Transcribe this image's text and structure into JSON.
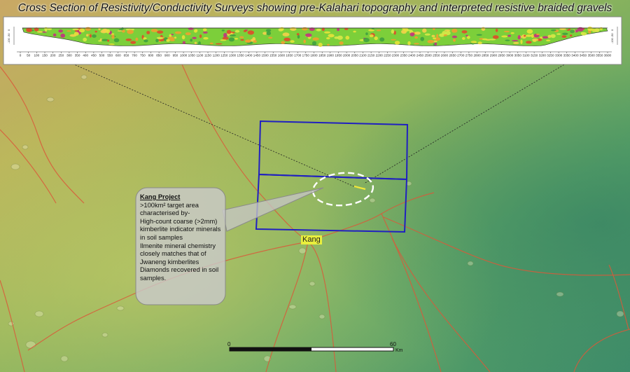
{
  "title": "Cross Section  of Resistivity/Conductivity Surveys showing pre-Kalahari topography  and interpreted resistive braided gravels",
  "cross_section": {
    "x_ticks": [
      "0",
      "50",
      "100",
      "150",
      "200",
      "250",
      "300",
      "350",
      "400",
      "450",
      "500",
      "550",
      "600",
      "650",
      "700",
      "750",
      "800",
      "850",
      "900",
      "950",
      "1000",
      "1050",
      "1100",
      "1150",
      "1200",
      "1250",
      "1300",
      "1350",
      "1400",
      "1450",
      "1500",
      "1550",
      "1600",
      "1650",
      "1700",
      "1750",
      "1800",
      "1850",
      "1900",
      "1950",
      "2000",
      "2050",
      "2100",
      "2150",
      "2200",
      "2250",
      "2300",
      "2350",
      "2400",
      "2450",
      "2500",
      "2550",
      "2600",
      "2650",
      "2700",
      "2750",
      "2800",
      "2850",
      "2900",
      "2950",
      "3000",
      "3050",
      "3100",
      "3150",
      "3200",
      "3250",
      "3300",
      "3350",
      "3400",
      "3450",
      "3500",
      "3550",
      "3600"
    ],
    "depth_ticks": [
      "0",
      "-50",
      "-100"
    ]
  },
  "callout": {
    "heading": "Kang Project",
    "lines": [
      ">100km² target area",
      "characterised by-",
      "High-count coarse (>2mm)",
      "kimberlite indicator minerals",
      "in soil samples",
      "Ilmenite mineral chemistry",
      "closely matches that of",
      "Jwaneng  kimberlites",
      "Diamonds recovered in soil",
      "samples."
    ]
  },
  "place_label": "Kang",
  "scale_bar": {
    "start": "0",
    "end": "60",
    "unit": "Km"
  },
  "colors": {
    "target_box": "#2020c0",
    "road": "#d9593a",
    "ellipse": "#ffffff",
    "section_line": "#f2e83a",
    "place_label_bg": "#e9ef3d"
  }
}
